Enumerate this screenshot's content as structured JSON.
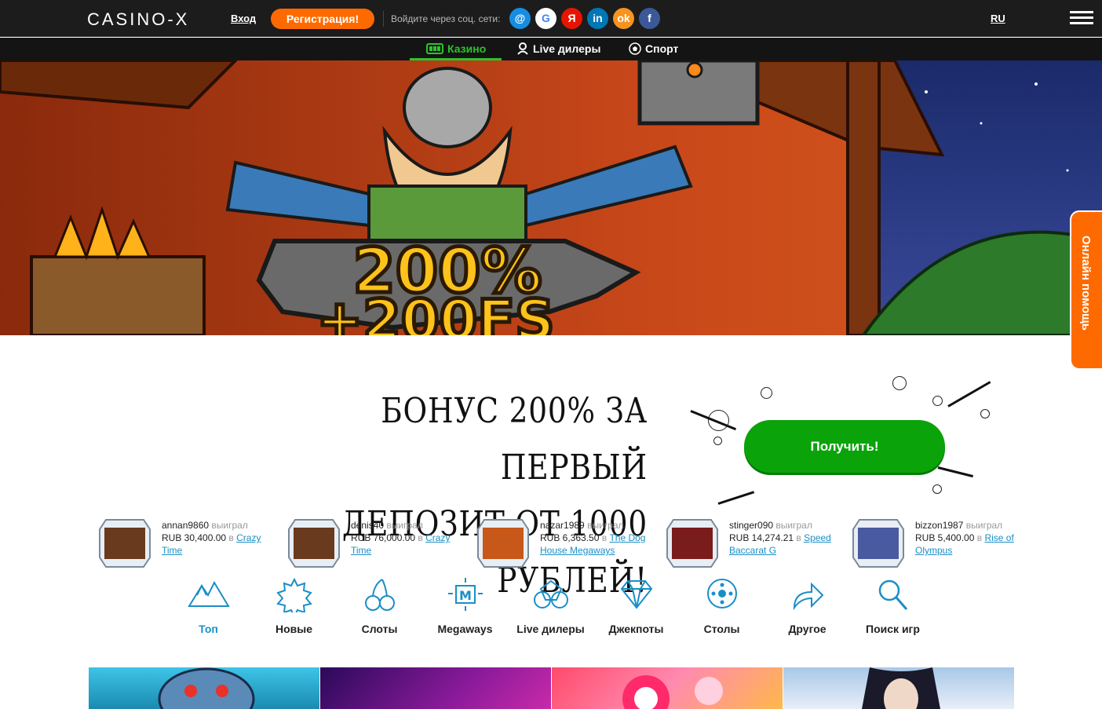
{
  "header": {
    "logo": "CASINO-X",
    "login": "Вход",
    "register": "Регистрация!",
    "social_label": "Войдите через соц. сети:",
    "social": [
      {
        "name": "mail-icon",
        "glyph": "@",
        "color": "#168de2"
      },
      {
        "name": "google-icon",
        "glyph": "G",
        "color": "#ffffff"
      },
      {
        "name": "yandex-icon",
        "glyph": "Я",
        "color": "#e61400"
      },
      {
        "name": "linkedin-icon",
        "glyph": "in",
        "color": "#0077b5"
      },
      {
        "name": "odnoklassniki-icon",
        "glyph": "ok",
        "color": "#f7931e"
      },
      {
        "name": "facebook-icon",
        "glyph": "f",
        "color": "#3b5998"
      }
    ],
    "lang": "RU"
  },
  "subnav": {
    "casino": "Казино",
    "live": "Live дилеры",
    "sport": "Спорт"
  },
  "banner": {
    "line1": "200%",
    "line2": "+200FS"
  },
  "help_tab": "Онлайн помощь",
  "promo": {
    "line1": "БОНУС 200% ЗА ПЕРВЫЙ",
    "line2": "ДЕПОЗИТ ОТ 1000 РУБЛЕЙ!",
    "button": "Получить!"
  },
  "winners": [
    {
      "user": "annan9860",
      "won": "выиграл",
      "amount": "RUB 30,400.00",
      "in": "в",
      "game": "Crazy Time",
      "thumb_color": "#6a3a1e"
    },
    {
      "user": "denis40",
      "won": "выиграл",
      "amount": "RUB 76,000.00",
      "in": "в",
      "game": "Crazy Time",
      "thumb_color": "#6a3a1e"
    },
    {
      "user": "nazar1989",
      "won": "выиграл",
      "amount": "RUB 6,363.50",
      "in": "в",
      "game": "The Dog House Megaways",
      "thumb_color": "#c8571a"
    },
    {
      "user": "stinger090",
      "won": "выиграл",
      "amount": "RUB 14,274.21",
      "in": "в",
      "game": "Speed Baccarat G",
      "thumb_color": "#7a1c1c"
    },
    {
      "user": "bizzon1987",
      "won": "выиграл",
      "amount": "RUB 5,400.00",
      "in": "в",
      "game": "Rise of Olympus",
      "thumb_color": "#4a5aa0"
    }
  ],
  "categories": [
    {
      "name": "top",
      "label": "Топ",
      "active": true
    },
    {
      "name": "new",
      "label": "Новые",
      "active": false
    },
    {
      "name": "slots",
      "label": "Слоты",
      "active": false
    },
    {
      "name": "megaways",
      "label": "Megaways",
      "active": false
    },
    {
      "name": "live-dealers",
      "label": "Live дилеры",
      "active": false
    },
    {
      "name": "jackpots",
      "label": "Джекпоты",
      "active": false
    },
    {
      "name": "tables",
      "label": "Столы",
      "active": false
    },
    {
      "name": "other",
      "label": "Другое",
      "active": false
    },
    {
      "name": "game-search",
      "label": "Поиск игр",
      "active": false
    }
  ],
  "colors": {
    "accent_orange": "#ff6a00",
    "accent_green": "#0aa30a",
    "link_blue": "#1a8fc6",
    "header_bg": "#1c1c1c"
  }
}
